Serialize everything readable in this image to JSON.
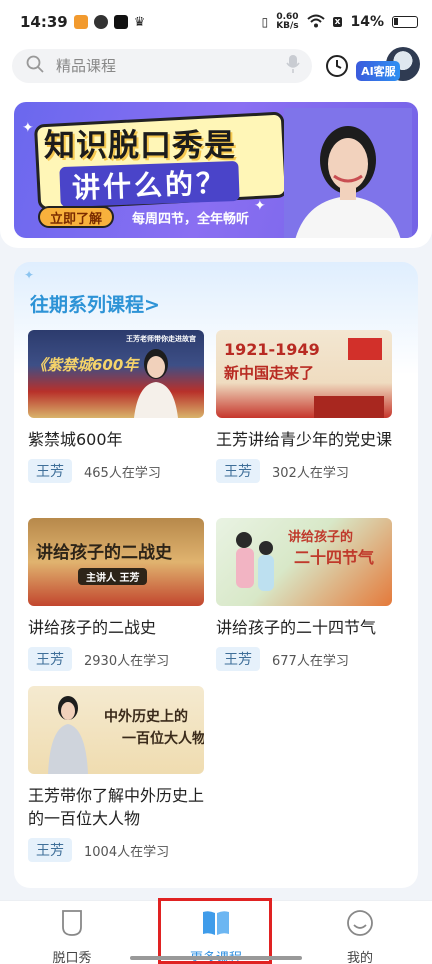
{
  "status_bar": {
    "time": "14:39",
    "net_speed_value": "0.60",
    "net_speed_unit": "KB/s",
    "battery": "14%"
  },
  "search": {
    "placeholder": "精品课程"
  },
  "ai_service": {
    "label": "AI客服"
  },
  "banner": {
    "title_line1": "知识脱口秀是",
    "title_line2": "讲什么的？",
    "cta": "立即了解",
    "subtitle": "每周四节，全年畅听"
  },
  "series": {
    "title": "往期系列课程>",
    "courses": [
      {
        "name": "紫禁城600年",
        "teacher": "王芳",
        "learners": "465人在学习",
        "thumb_text": "《紫禁城600年",
        "thumb_sub": "王芳老师带你走进故宫"
      },
      {
        "name": "王芳讲给青少年的党史课",
        "teacher": "王芳",
        "learners": "302人在学习",
        "thumb_text": "1921-1949",
        "thumb_sub": "新中国走来了"
      },
      {
        "name": "讲给孩子的二战史",
        "teacher": "王芳",
        "learners": "2930人在学习",
        "thumb_text": "讲给孩子的二战史",
        "thumb_sub": "主讲人 王芳"
      },
      {
        "name": "讲给孩子的二十四节气",
        "teacher": "王芳",
        "learners": "677人在学习",
        "thumb_text": "讲给孩子的",
        "thumb_sub": "二十四节气"
      },
      {
        "name": "王芳带你了解中外历史上的一百位大人物",
        "teacher": "王芳",
        "learners": "1004人在学习",
        "thumb_text": "中外历史上的",
        "thumb_sub": "一百位大人物"
      }
    ]
  },
  "bottom_nav": {
    "items": [
      {
        "label": "脱口秀"
      },
      {
        "label": "更多课程"
      },
      {
        "label": "我的"
      }
    ],
    "active_color": "#2f8fe0"
  }
}
